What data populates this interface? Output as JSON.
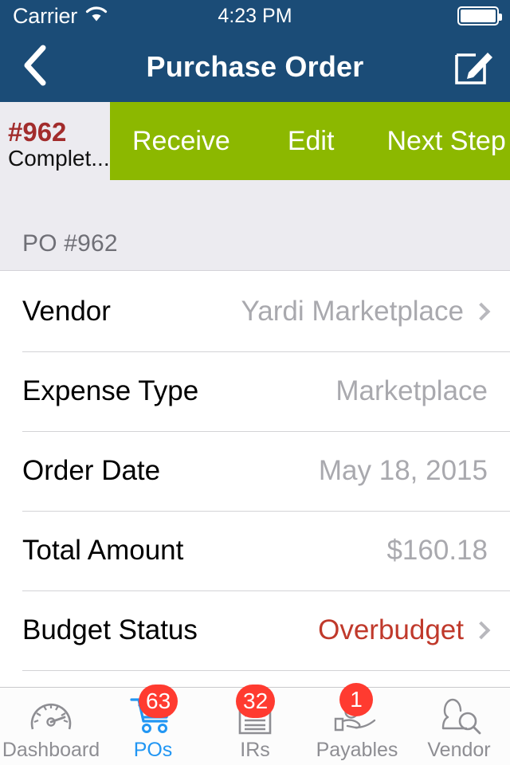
{
  "statusbar": {
    "carrier": "Carrier",
    "wifi_icon": "wifi-icon",
    "time": "4:23 PM",
    "battery_icon": "battery-full-icon"
  },
  "navbar": {
    "back_icon": "chevron-left-icon",
    "title": "Purchase Order",
    "action_icon": "compose-icon"
  },
  "actionbar": {
    "po_number": "#962",
    "po_status": "Complet...",
    "buttons": [
      {
        "label": "Receive"
      },
      {
        "label": "Edit"
      },
      {
        "label": "Next Step"
      }
    ]
  },
  "section": {
    "header": "PO #962"
  },
  "details": {
    "rows": [
      {
        "label": "Vendor",
        "value": "Yardi Marketplace",
        "chevron": true,
        "alert": false
      },
      {
        "label": "Expense Type",
        "value": "Marketplace",
        "chevron": false,
        "alert": false
      },
      {
        "label": "Order Date",
        "value": "May 18, 2015",
        "chevron": false,
        "alert": false
      },
      {
        "label": "Total Amount",
        "value": "$160.18",
        "chevron": false,
        "alert": false
      },
      {
        "label": "Budget Status",
        "value": "Overbudget",
        "chevron": true,
        "alert": true
      }
    ]
  },
  "tabbar": {
    "items": [
      {
        "label": "Dashboard",
        "icon": "gauge-icon",
        "badge": null,
        "active": false
      },
      {
        "label": "POs",
        "icon": "shopping-cart-icon",
        "badge": "63",
        "active": true
      },
      {
        "label": "IRs",
        "icon": "invoice-doc-icon",
        "badge": "32",
        "active": false
      },
      {
        "label": "Payables",
        "icon": "hand-coins-icon",
        "badge": "1",
        "active": false
      },
      {
        "label": "Vendor",
        "icon": "person-search-icon",
        "badge": null,
        "active": false
      }
    ]
  },
  "colors": {
    "navy": "#1b4c77",
    "green": "#8cb800",
    "badge_red": "#ff3b30",
    "alert_red": "#c0392b",
    "po_number_red": "#a22c2c",
    "active_blue": "#2196f3",
    "section_bg": "#ecebf0"
  }
}
